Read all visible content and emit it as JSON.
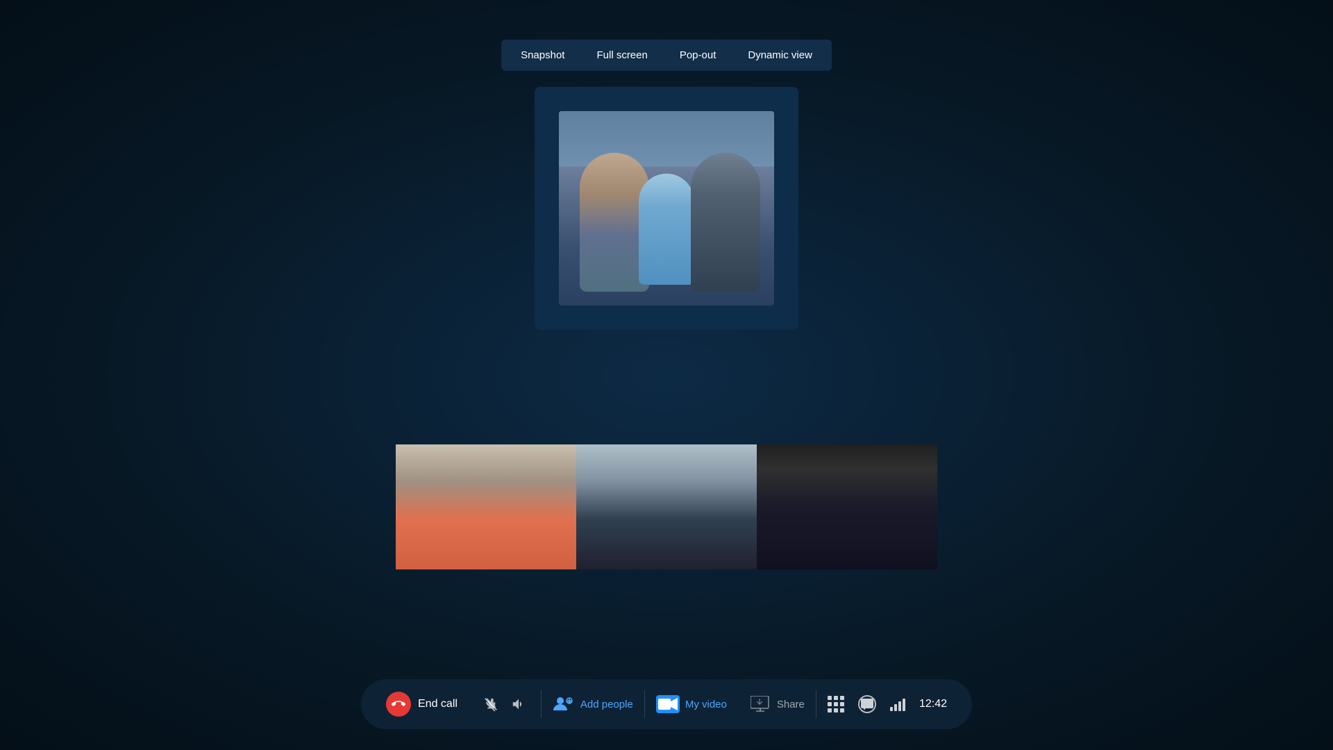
{
  "toolbar": {
    "snapshot_label": "Snapshot",
    "fullscreen_label": "Full screen",
    "popout_label": "Pop-out",
    "dynamic_label": "Dynamic view"
  },
  "call_bar": {
    "end_call_label": "End call",
    "add_people_label": "Add people",
    "my_video_label": "My video",
    "share_label": "Share",
    "time": "12:42"
  },
  "thumbnails": [
    {
      "id": "girl",
      "type": "girl"
    },
    {
      "id": "woman",
      "type": "woman"
    },
    {
      "id": "man",
      "type": "man"
    }
  ]
}
